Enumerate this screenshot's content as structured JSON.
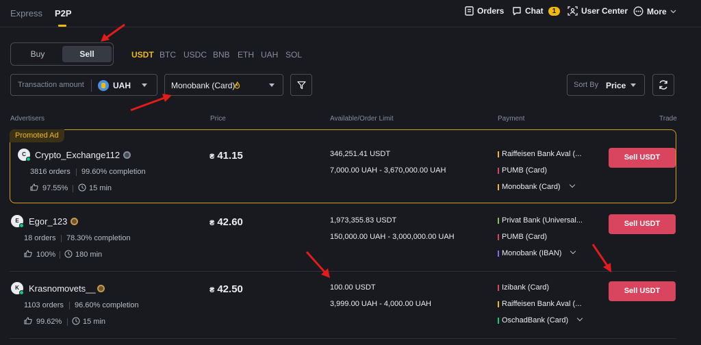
{
  "nav": {
    "tabs": [
      "Express",
      "P2P"
    ],
    "orders": "Orders",
    "chat": "Chat",
    "chat_count": "1",
    "user_center": "User Center",
    "more": "More"
  },
  "trade_toggle": {
    "buy": "Buy",
    "sell": "Sell",
    "selected": "Sell"
  },
  "assets": [
    "USDT",
    "BTC",
    "USDC",
    "BNB",
    "ETH",
    "UAH",
    "SOL"
  ],
  "selected_asset": "USDT",
  "filters": {
    "amount_label": "Transaction amount",
    "currency": "UAH",
    "payment": "Monobank (Card)",
    "sort_label": "Sort By",
    "sort_value": "Price"
  },
  "table_headers": {
    "advertisers": "Advertisers",
    "price": "Price",
    "available": "Available/Order Limit",
    "payment": "Payment",
    "trade": "Trade"
  },
  "promo_label": "Promoted Ad",
  "ads": [
    {
      "initial": "C",
      "name": "Crypto_Exchange112",
      "orders": "3816 orders",
      "completion": "99.60% completion",
      "rating": "97.55%",
      "time": "15 min",
      "currency_symbol": "₴",
      "price": "41.15",
      "available": "346,251.41 USDT",
      "limit": "7,000.00 UAH - 3,670,000.00 UAH",
      "payments": [
        {
          "name": "Raiffeisen Bank Aval (...",
          "color": "#f0b90b"
        },
        {
          "name": "PUMB (Card)",
          "color": "#d9455f"
        },
        {
          "name": "Monobank (Card)",
          "color": "#f0b90b"
        }
      ],
      "button": "Sell USDT"
    },
    {
      "initial": "E",
      "name": "Egor_123",
      "orders": "18 orders",
      "completion": "78.30% completion",
      "rating": "100%",
      "time": "180 min",
      "currency_symbol": "₴",
      "price": "42.60",
      "available": "1,973,355.83 USDT",
      "limit": "150,000.00 UAH - 3,000,000.00 UAH",
      "payments": [
        {
          "name": "Privat Bank (Universal...",
          "color": "#8cc152"
        },
        {
          "name": "PUMB (Card)",
          "color": "#d9455f"
        },
        {
          "name": "Monobank (IBAN)",
          "color": "#7a6ff0"
        }
      ],
      "button": "Sell USDT"
    },
    {
      "initial": "K",
      "name": "Krasnomovets__",
      "orders": "1103 orders",
      "completion": "96.60% completion",
      "rating": "99.62%",
      "time": "15 min",
      "currency_symbol": "₴",
      "price": "42.50",
      "available": "100.00 USDT",
      "limit": "3,999.00 UAH - 4,000.00 UAH",
      "payments": [
        {
          "name": "Izibank (Card)",
          "color": "#d9455f"
        },
        {
          "name": "Raiffeisen Bank Aval (...",
          "color": "#f0b90b"
        },
        {
          "name": "OschadBank (Card)",
          "color": "#0ecb81"
        }
      ],
      "button": "Sell USDT"
    }
  ]
}
